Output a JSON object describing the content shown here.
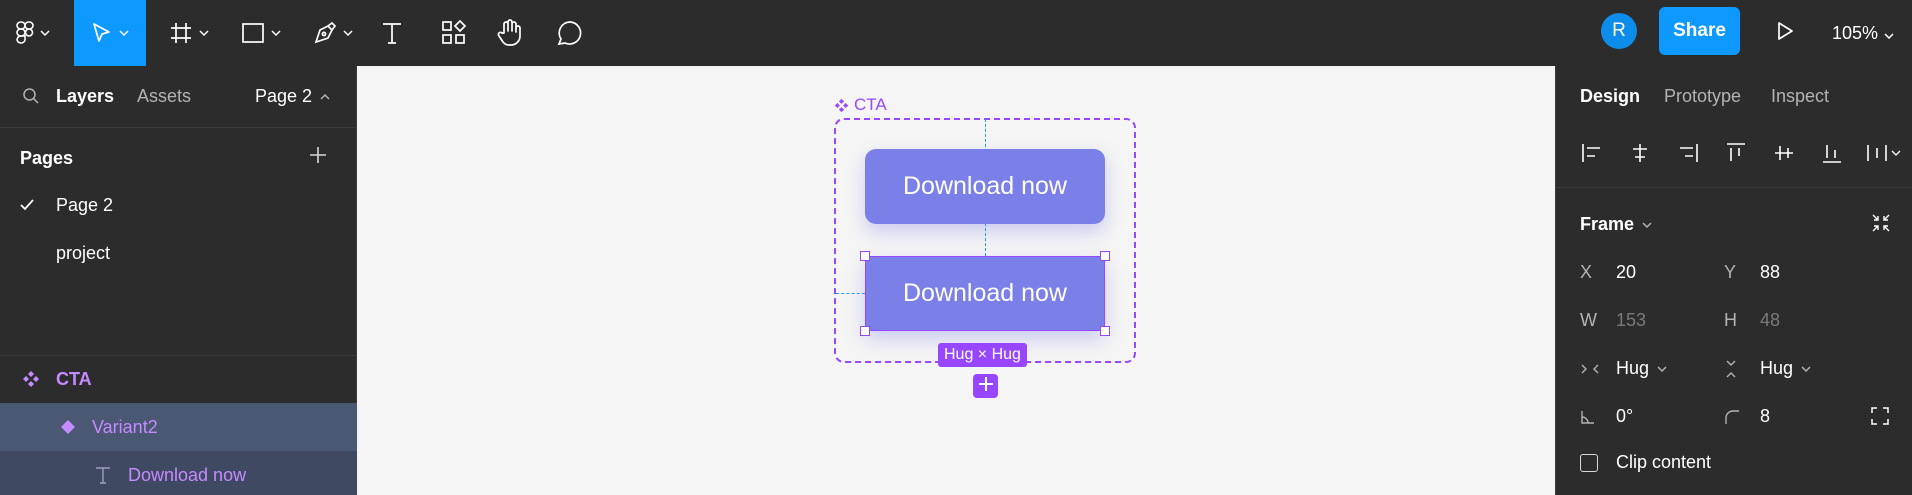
{
  "toolbar": {
    "tools": [
      "figma-menu",
      "move",
      "frame",
      "shape",
      "pen",
      "text",
      "resources",
      "hand",
      "comment"
    ],
    "avatar_initial": "R",
    "share_label": "Share",
    "zoom_label": "105%",
    "accent": "#0d99ff"
  },
  "left_panel": {
    "tabs": {
      "layers": "Layers",
      "assets": "Assets"
    },
    "current_page": "Page 2",
    "pages_heading": "Pages",
    "pages": [
      {
        "label": "Page 2",
        "selected": true
      },
      {
        "label": "project",
        "selected": false
      }
    ],
    "layers": [
      {
        "label": "CTA",
        "kind": "component-set"
      },
      {
        "label": "Variant2",
        "kind": "variant"
      },
      {
        "label": "Download now",
        "kind": "text"
      }
    ]
  },
  "canvas": {
    "component_label": "CTA",
    "button_1_label": "Download now",
    "button_2_label": "Download now",
    "hug_badge": "Hug × Hug",
    "component_color": "#9747ff",
    "button_color": "#7b7fe8"
  },
  "right_panel": {
    "tabs": {
      "design": "Design",
      "prototype": "Prototype",
      "inspect": "Inspect"
    },
    "section_title": "Frame",
    "props": {
      "x_label": "X",
      "x_value": "20",
      "y_label": "Y",
      "y_value": "88",
      "w_label": "W",
      "w_value": "153",
      "h_label": "H",
      "h_value": "48",
      "hresize_value": "Hug",
      "vresize_value": "Hug",
      "rotation_value": "0°",
      "radius_value": "8"
    },
    "clip_content_label": "Clip content",
    "clip_content_checked": false
  }
}
